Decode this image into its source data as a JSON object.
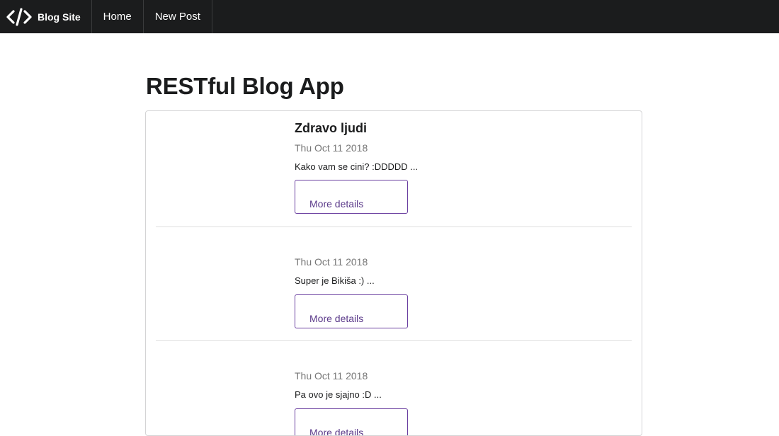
{
  "navbar": {
    "brand_icon": "code-icon",
    "brand_label": "Blog Site",
    "items": [
      {
        "label": "Home"
      },
      {
        "label": "New Post"
      }
    ]
  },
  "page": {
    "title": "RESTful Blog App"
  },
  "posts": [
    {
      "title": "Zdravo ljudi",
      "date": "Thu Oct 11 2018",
      "excerpt": "Kako vam se cini? :DDDDD ...",
      "button_label": "More details"
    },
    {
      "title": "",
      "date": "Thu Oct 11 2018",
      "excerpt": "Super je Bikiša :) ...",
      "button_label": "More details"
    },
    {
      "title": "",
      "date": "Thu Oct 11 2018",
      "excerpt": "Pa ovo je sjajno :D ...",
      "button_label": "More details"
    }
  ],
  "colors": {
    "navbar_bg": "#1b1c1d",
    "button_border": "#6a3fa0",
    "button_text": "#5b3a8a",
    "date_text": "#777777"
  }
}
